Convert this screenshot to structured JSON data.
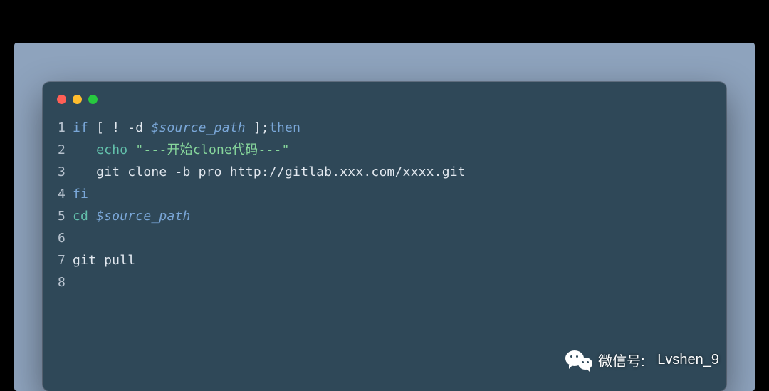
{
  "code": {
    "lines": [
      {
        "n": "1",
        "tokens": [
          {
            "cls": "tok-keyword",
            "t": "if"
          },
          {
            "cls": "tok-plain",
            "t": " [ ! -d "
          },
          {
            "cls": "tok-var",
            "t": "$source_path"
          },
          {
            "cls": "tok-plain",
            "t": " ];"
          },
          {
            "cls": "tok-keyword",
            "t": "then"
          }
        ]
      },
      {
        "n": "2",
        "tokens": [
          {
            "cls": "tok-plain",
            "t": "   "
          },
          {
            "cls": "tok-builtin",
            "t": "echo"
          },
          {
            "cls": "tok-plain",
            "t": " "
          },
          {
            "cls": "tok-string",
            "t": "\"---开始clone代码---\""
          }
        ]
      },
      {
        "n": "3",
        "tokens": [
          {
            "cls": "tok-plain",
            "t": "   git clone -b pro http://gitlab.xxx.com/xxxx.git"
          }
        ]
      },
      {
        "n": "4",
        "tokens": [
          {
            "cls": "tok-keyword",
            "t": "fi"
          }
        ]
      },
      {
        "n": "5",
        "tokens": [
          {
            "cls": "tok-builtin",
            "t": "cd"
          },
          {
            "cls": "tok-plain",
            "t": " "
          },
          {
            "cls": "tok-var",
            "t": "$source_path"
          }
        ]
      },
      {
        "n": "6",
        "tokens": []
      },
      {
        "n": "7",
        "tokens": [
          {
            "cls": "tok-plain",
            "t": "git pull"
          }
        ]
      },
      {
        "n": "8",
        "tokens": []
      }
    ]
  },
  "watermark": {
    "label_prefix": "微信号:",
    "handle": "Lvshen_9"
  }
}
